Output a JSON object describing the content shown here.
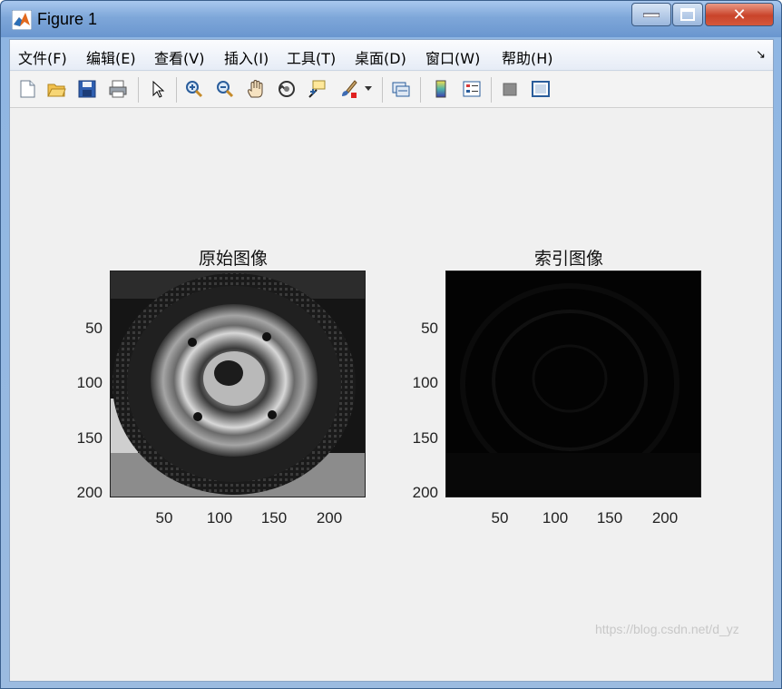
{
  "window": {
    "title": "Figure 1",
    "close_symbol": "✕"
  },
  "menu": {
    "items": [
      "文件(F)",
      "编辑(E)",
      "查看(V)",
      "插入(I)",
      "工具(T)",
      "桌面(D)",
      "窗口(W)",
      "帮助(H)"
    ],
    "corner_icon": "dock-arrow-icon"
  },
  "toolbar": {
    "buttons": [
      "new-figure-icon",
      "open-file-icon",
      "save-icon",
      "print-icon",
      "edit-plot-arrow-icon",
      "zoom-in-icon",
      "zoom-out-icon",
      "pan-hand-icon",
      "rotate-3d-icon",
      "data-cursor-icon",
      "brush-icon",
      "brush-dropdown-icon",
      "link-plot-icon",
      "insert-colorbar-icon",
      "insert-legend-icon",
      "hide-plot-tools-icon",
      "show-plot-tools-icon"
    ]
  },
  "axes": [
    {
      "title": "原始图像",
      "yticks": [
        "50",
        "100",
        "150",
        "200"
      ],
      "xticks": [
        "50",
        "100",
        "150",
        "200"
      ],
      "image": "grayscale-car-tire-photo"
    },
    {
      "title": "索引图像",
      "yticks": [
        "50",
        "100",
        "150",
        "200"
      ],
      "xticks": [
        "50",
        "100",
        "150",
        "200"
      ],
      "image": "near-black-indexed-tire-image"
    }
  ],
  "watermark": "https://blog.csdn.net/d_yz"
}
